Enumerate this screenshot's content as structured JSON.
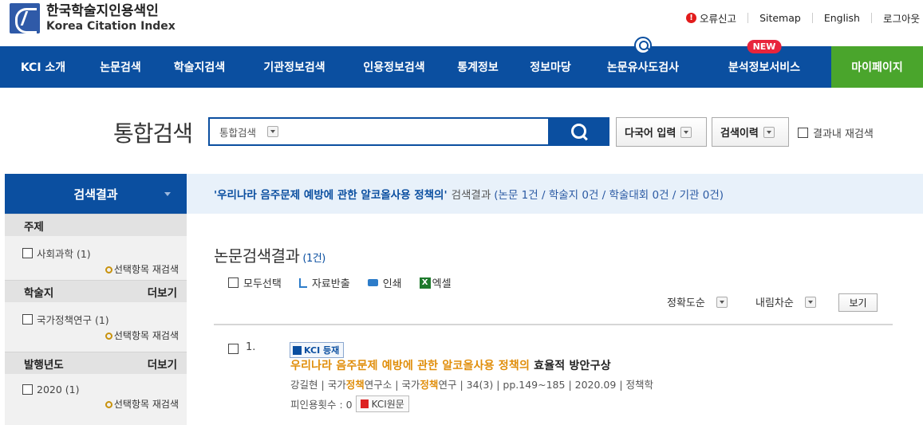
{
  "header": {
    "logo_ko": "한국학술지인용색인",
    "logo_en": "Korea Citation Index",
    "util": {
      "error_report": "오류신고",
      "sitemap": "Sitemap",
      "english": "English",
      "logout": "로그아웃"
    }
  },
  "nav": {
    "items": [
      {
        "label": "KCI 소개"
      },
      {
        "label": "논문검색"
      },
      {
        "label": "학술지검색"
      },
      {
        "label": "기관정보검색"
      },
      {
        "label": "인용정보검색"
      },
      {
        "label": "통계정보"
      },
      {
        "label": "정보마당"
      },
      {
        "label": "논문유사도검사"
      },
      {
        "label": "분석정보서비스",
        "badge": "NEW"
      },
      {
        "label": "마이페이지"
      }
    ],
    "bg_color": "#0b4fa0",
    "mypage_color": "#4aa52c"
  },
  "search": {
    "title": "통합검색",
    "scope": "통합검색",
    "query": "",
    "multilang_button": "다국어 입력",
    "history_button": "검색이력",
    "reinline_label": "결과내 재검색"
  },
  "sidebar": {
    "header": "검색결과",
    "facets": [
      {
        "title": "주제",
        "more": "",
        "item": "사회과학  (1)",
        "refilter": "선택항목 재검색"
      },
      {
        "title": "학술지",
        "more": "더보기",
        "item": "국가정책연구 (1)",
        "refilter": "선택항목 재검색"
      },
      {
        "title": "발행년도",
        "more": "더보기",
        "item": "2020 (1)",
        "refilter": "선택항목 재검색"
      }
    ]
  },
  "results": {
    "query_text": "'우리나라 음주문제 예방에 관한 알코올사용 정책의'",
    "summary_label": "검색결과",
    "summary_counts": "(논문 1건 / 학술지 0건 / 학술대회 0건 / 기관 0건)",
    "section_title": "논문검색결과",
    "section_count": "(1건)",
    "actions": {
      "select_all": "모두선택",
      "export": "자료반출",
      "print": "인쇄",
      "excel": "엑셀"
    },
    "sort_field": "정확도순",
    "sort_order": "내림차순",
    "view_button": "보기",
    "items": [
      {
        "no": "1.",
        "badge": "KCI 등재",
        "title_highlight": "우리나라 음주문제 예방에 관한 알코올사용 정책의",
        "title_rest": " 효율적 방안구상",
        "author": "강길현",
        "publisher_pre": "국가",
        "publisher_hl": "정책",
        "publisher_post": "연구소",
        "journal_pre": "국가",
        "journal_hl": "정책",
        "journal_post": "연구",
        "volume": "34(3)",
        "pages": "pp.149~185",
        "date": "2020.09",
        "subject": "정책학",
        "cited_label": "피인용횟수 : 0",
        "original_button": "KCI원문"
      }
    ]
  }
}
